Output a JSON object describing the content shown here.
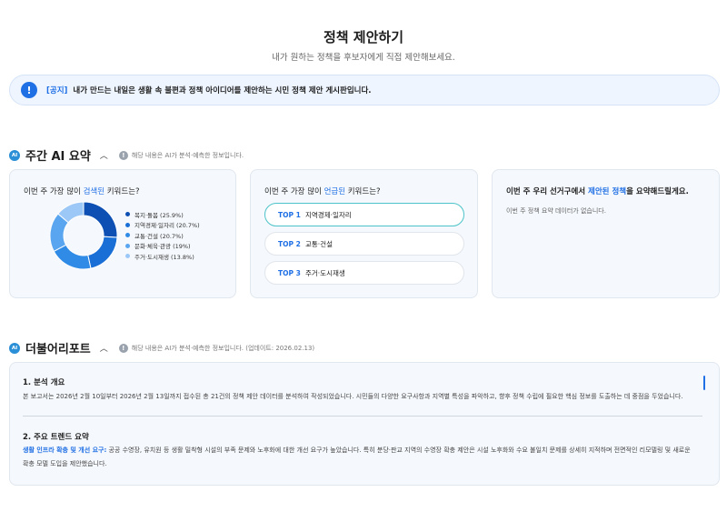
{
  "page": {
    "title": "정책 제안하기",
    "subtitle": "내가 원하는 정책을 후보자에게 직접 제안해보세요."
  },
  "notice": {
    "icon": "exclamation-icon",
    "tag": "[공지]",
    "text": "내가 만드는 내일은 생활 속 불편과 정책 아이디어를 제안하는 시민 정책 제안 게시판입니다."
  },
  "weekly": {
    "badge": "AI",
    "title": "주간 AI 요약",
    "chevron": "︿",
    "info_icon": "!",
    "info_text": "해당 내용은 AI가 분석·예측한 정보입니다.",
    "cards": {
      "searched": {
        "title_pre": "이번 주 가장 많이 ",
        "title_hl": "검색된",
        "title_post": " 키워드는?"
      },
      "mentioned": {
        "title_pre": "이번 주 가장 많이 ",
        "title_hl": "언급된",
        "title_post": " 키워드는?",
        "items": [
          {
            "rank": "TOP 1",
            "label": "지역경제·일자리"
          },
          {
            "rank": "TOP 2",
            "label": "교통·건설"
          },
          {
            "rank": "TOP 3",
            "label": "주거·도시재생"
          }
        ]
      },
      "proposed": {
        "title_pre": "이번 주 우리 선거구에서 ",
        "title_hl": "제안된 정책",
        "title_post": "을 요약해드릴게요.",
        "empty_text": "이번 주 정책 요약 데이터가 없습니다."
      }
    }
  },
  "chart_data": {
    "type": "pie",
    "categories": [
      "복지·돌봄",
      "지역경제·일자리",
      "교통·건설",
      "문화·체육·관광",
      "주거·도시재생"
    ],
    "values": [
      25.9,
      20.7,
      20.7,
      19,
      13.8
    ],
    "labels": [
      "복지·돌봄 (25.9%)",
      "지역경제·일자리 (20.7%)",
      "교통·건설 (20.7%)",
      "문화·체육·관광 (19%)",
      "주거·도시재생 (13.8%)"
    ],
    "colors": [
      "#0d4fb3",
      "#1a6fd6",
      "#2f8be6",
      "#5aa5ef",
      "#9cc8f7"
    ],
    "donut": true
  },
  "report": {
    "badge": "AI",
    "title": "더불어리포트",
    "chevron": "︿",
    "info_icon": "!",
    "info_text": "해당 내용은 AI가 분석·예측한 정보입니다. (업데이트: 2026.02.13)",
    "sections": [
      {
        "heading": "1. 분석 개요",
        "body": "본 보고서는 2026년 2월 10일부터 2026년 2월 13일까지 접수된 총 21건의 정책 제안 데이터를 분석하여 작성되었습니다. 시민들의 다양한 요구사항과 지역별 특성을 파악하고, 향후 정책 수립에 필요한 핵심 정보를 도출하는 데 중점을 두었습니다."
      },
      {
        "heading": "2. 주요 트렌드 요약",
        "body_label": "생활 인프라 확충 및 개선 요구:",
        "body": " 공공 수영장, 유치원 등 생활 밀착형 시설의 부족 문제와 노후화에 대한 개선 요구가 높았습니다. 특히 분당·판교 지역의 수영장 확충 제안은 시설 노후화와 수요 불일치 문제를 상세히 지적하며 전면적인 리모델링 및 새로운 확충 모델 도입을 제안했습니다."
      }
    ]
  }
}
